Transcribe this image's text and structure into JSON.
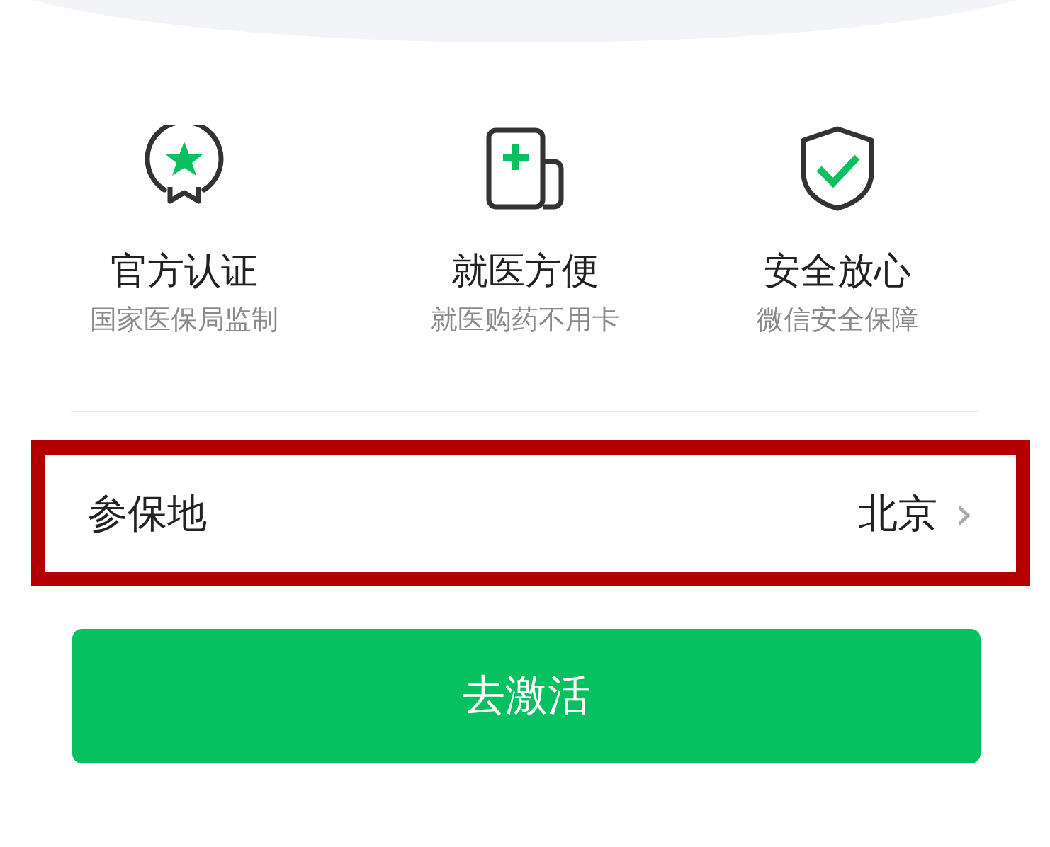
{
  "features": [
    {
      "title": "官方认证",
      "subtitle": "国家医保局监制"
    },
    {
      "title": "就医方便",
      "subtitle": "就医购药不用卡"
    },
    {
      "title": "安全放心",
      "subtitle": "微信安全保障"
    }
  ],
  "insured_location": {
    "label": "参保地",
    "value": "北京",
    "chevron": "›",
    "highlighted": true
  },
  "activate_button": "去激活"
}
